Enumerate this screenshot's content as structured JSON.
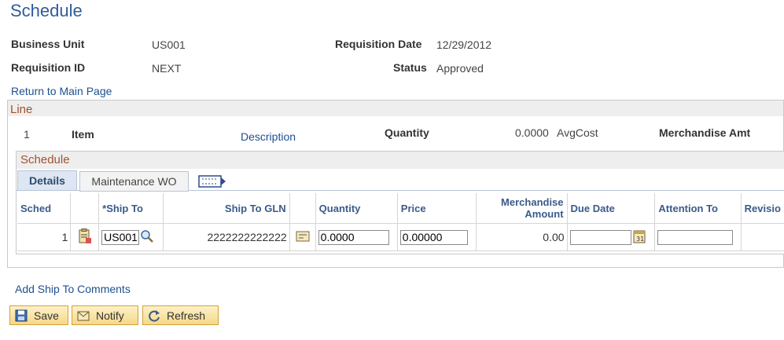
{
  "page": {
    "title": "Schedule"
  },
  "header": {
    "business_unit_label": "Business Unit",
    "business_unit": "US001",
    "requisition_id_label": "Requisition ID",
    "requisition_id": "NEXT",
    "requisition_date_label": "Requisition Date",
    "requisition_date": "12/29/2012",
    "status_label": "Status",
    "status": "Approved"
  },
  "return_link": "Return to Main Page",
  "line": {
    "section_title": "Line",
    "number": "1",
    "item_label": "Item",
    "description_link": "Description",
    "quantity_label": "Quantity",
    "quantity": "0.0000",
    "uom": "AvgCost",
    "merch_amt_label": "Merchandise Amt"
  },
  "schedule": {
    "section_title": "Schedule",
    "tabs": [
      "Details",
      "Maintenance WO"
    ],
    "columns": {
      "sched": "Sched",
      "ship_to": "*Ship To",
      "ship_to_gln": "Ship To GLN",
      "quantity": "Quantity",
      "price": "Price",
      "merch_amount": "Merchandise Amount",
      "due_date": "Due Date",
      "attention_to": "Attention To",
      "revision": "Revisio"
    },
    "row": {
      "sched": "1",
      "ship_to": "US001",
      "ship_to_gln": "2222222222222",
      "quantity": "0.0000",
      "price": "0.00000",
      "merch_amount": "0.00",
      "due_date": "",
      "attention_to": ""
    }
  },
  "add_comments_link": "Add Ship To Comments",
  "buttons": {
    "save": "Save",
    "notify": "Notify",
    "refresh": "Refresh"
  }
}
